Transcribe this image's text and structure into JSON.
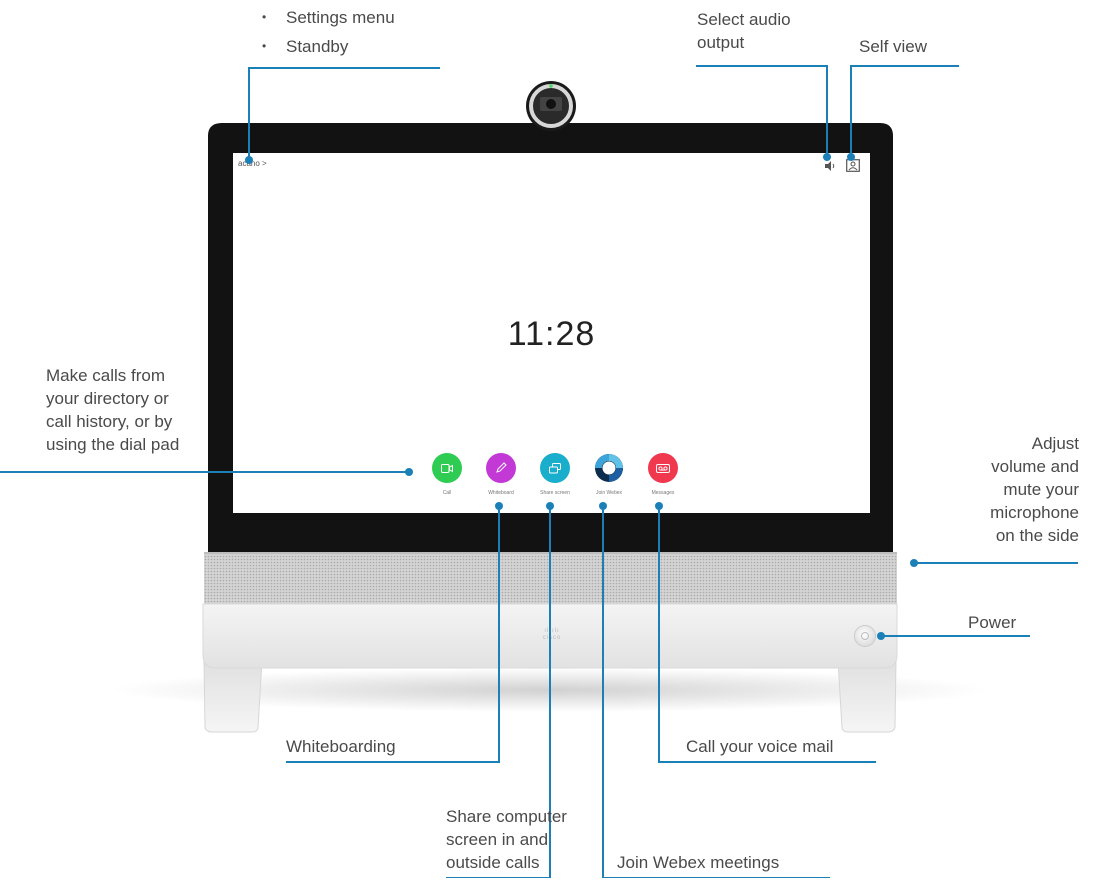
{
  "callouts": {
    "settings_items": [
      "Settings menu",
      "Standby"
    ],
    "audio_output": [
      "Select audio",
      "output"
    ],
    "self_view": "Self view",
    "make_calls": [
      "Make calls from",
      "your directory or",
      "call history, or by",
      "using the dial pad"
    ],
    "volume": [
      "Adjust",
      "volume and",
      "mute your",
      "microphone",
      "on the side"
    ],
    "power": "Power",
    "whiteboarding": "Whiteboarding",
    "voice_mail": "Call your voice mail",
    "share_screen": [
      "Share computer",
      "screen in and",
      "outside calls"
    ],
    "webex": "Join Webex meetings"
  },
  "screen": {
    "brand": "acano >",
    "clock": "11:28",
    "apps": [
      {
        "label": "Call",
        "color": "#2ecc52",
        "icon": "video-camera-icon"
      },
      {
        "label": "Whiteboard",
        "color": "#c339d6",
        "icon": "pencil-icon"
      },
      {
        "label": "Share screen",
        "color": "#19aecb",
        "icon": "share-screen-icon"
      },
      {
        "label": "Join Webex",
        "color": "#ffffff",
        "icon": "webex-logo-icon"
      },
      {
        "label": "Messages",
        "color": "#f0384f",
        "icon": "voicemail-icon"
      }
    ]
  },
  "device": {
    "logo_text": "cisco"
  },
  "colors": {
    "callout_line": "#1b80b8",
    "callout_dot": "#1b80b8",
    "bezel": "#111111",
    "speaker_grille": "#c8c8c8"
  }
}
